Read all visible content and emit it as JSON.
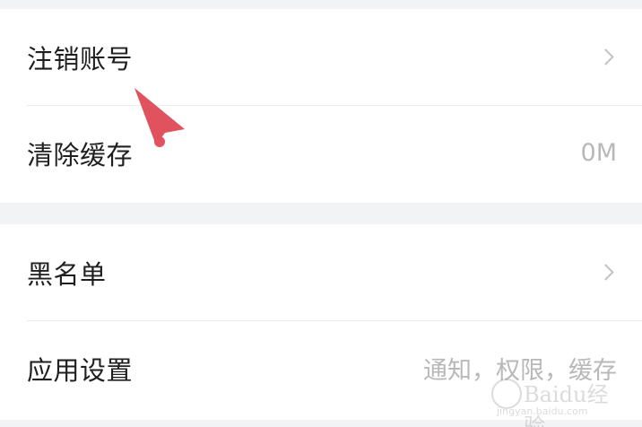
{
  "settings": {
    "group1": [
      {
        "label": "注销账号",
        "value": "",
        "has_chevron": true
      },
      {
        "label": "清除缓存",
        "value": "0M",
        "has_chevron": false
      }
    ],
    "group2": [
      {
        "label": "黑名单",
        "value": "",
        "has_chevron": true
      },
      {
        "label": "应用设置",
        "value": "通知，权限，缓存",
        "has_chevron": false
      }
    ]
  },
  "overlay": {
    "pointer_color": "#e0525e",
    "watermark_text": "Baidu经验",
    "watermark_sub": "jingyan.baidu.com"
  }
}
